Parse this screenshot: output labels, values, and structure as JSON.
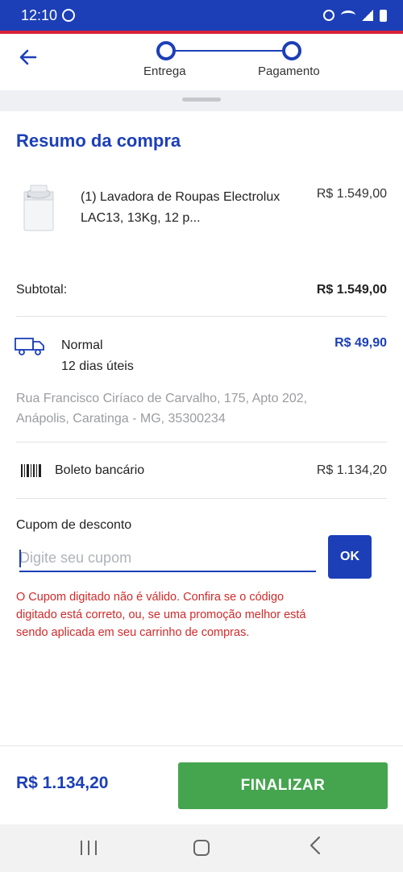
{
  "status_bar": {
    "time": "12:10",
    "icons": [
      "whatsapp-icon",
      "alarm-icon",
      "wifi-icon",
      "signal-icon",
      "battery-icon"
    ]
  },
  "colors": {
    "brand_blue": "#1c3fb8",
    "accent_red": "#d9223a",
    "error_red": "#d12a2a",
    "finish_green": "#45a54f"
  },
  "header": {
    "steps": [
      {
        "label": "Entrega"
      },
      {
        "label": "Pagamento"
      }
    ]
  },
  "summary": {
    "title": "Resumo da compra",
    "product": {
      "name": "(1) Lavadora de Roupas Electrolux LAC13, 13Kg, 12 p...",
      "price": "R$ 1.549,00"
    },
    "subtotal": {
      "label": "Subtotal:",
      "value": "R$ 1.549,00"
    },
    "shipping": {
      "method": "Normal",
      "eta": "12 dias úteis",
      "price": "R$ 49,90",
      "address": "Rua Francisco Ciríaco de Carvalho, 175, Apto 202, Anápolis, Caratinga - MG, 35300234"
    },
    "payment": {
      "method": "Boleto bancário",
      "value": "R$ 1.134,20"
    }
  },
  "coupon": {
    "label": "Cupom de desconto",
    "placeholder": "Digite seu cupom",
    "value": "",
    "ok_label": "OK",
    "error": "O Cupom digitado não é válido. Confira se o código digitado está correto, ou, se uma promoção melhor está sendo aplicada em seu carrinho de compras."
  },
  "footer": {
    "total": "R$ 1.134,20",
    "finish_label": "FINALIZAR"
  }
}
